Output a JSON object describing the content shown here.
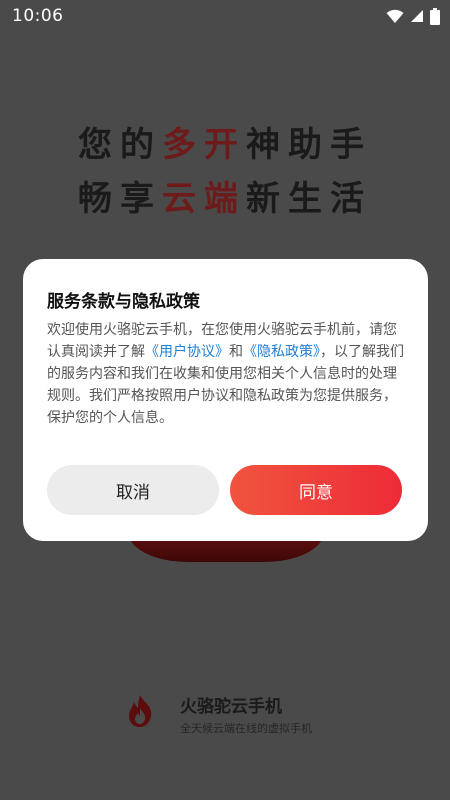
{
  "status_bar": {
    "time": "10:06",
    "icons": [
      "wifi-icon",
      "signal-icon",
      "battery-icon"
    ]
  },
  "splash": {
    "line1": {
      "a": "您的",
      "b": "多开",
      "c": "神助手"
    },
    "line2": {
      "a": "畅享",
      "b": "云端",
      "c": "新生活"
    }
  },
  "brand": {
    "name": "火骆驼云手机",
    "tagline": "全天候云端在线的虚拟手机",
    "logo_icon": "flame-icon"
  },
  "dialog": {
    "title": "服务条款与隐私政策",
    "body": {
      "part1": "欢迎使用火骆驼云手机，在您使用火骆驼云手机前，请您认真阅读并了解",
      "link_user_agreement": "《用户协议》",
      "part2": "和",
      "link_privacy_policy": "《隐私政策》",
      "part3": "，以了解我们的服务内容和我们在收集和使用您相关个人信息时的处理规则。我们严格按照用户协议和隐私政策为您提供服务，保护您的个人信息。"
    },
    "cancel_label": "取消",
    "agree_label": "同意"
  },
  "colors": {
    "accent": "#ee2b37",
    "link": "#1f7fd6",
    "overlay": "#4a4a4a"
  }
}
